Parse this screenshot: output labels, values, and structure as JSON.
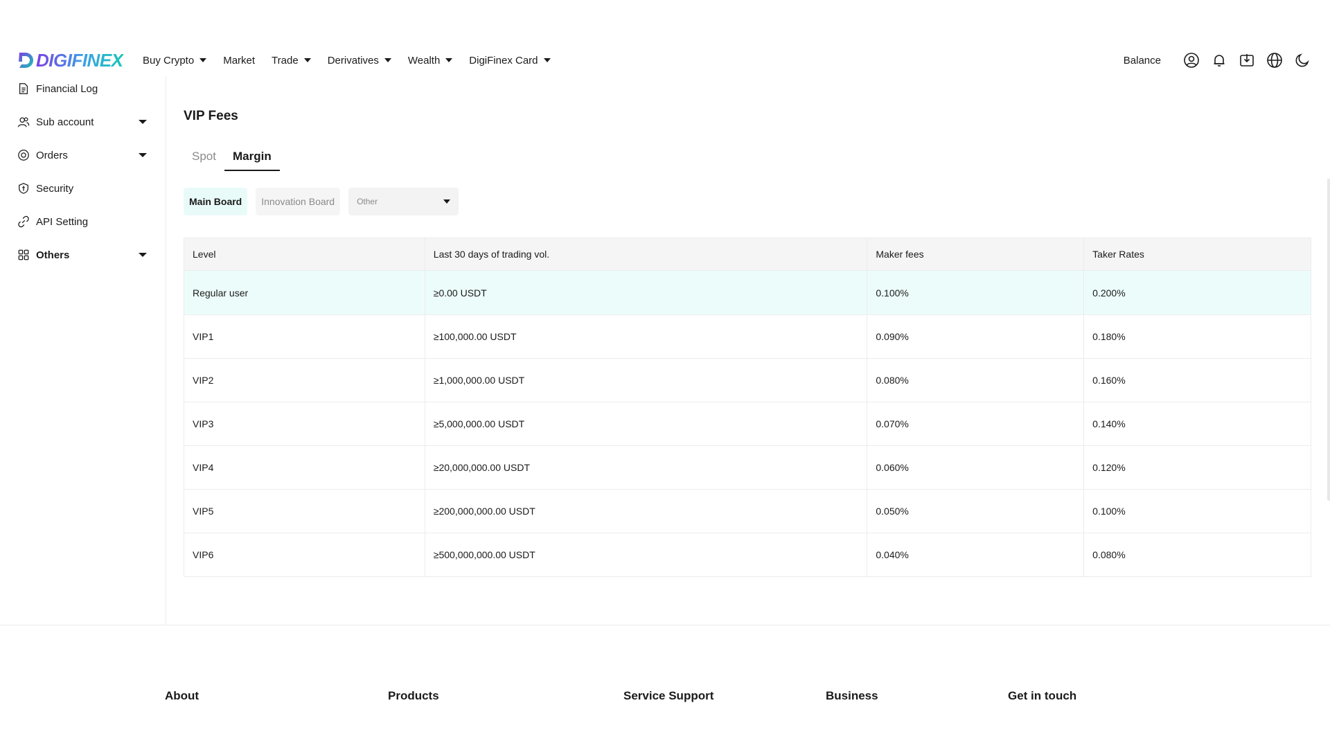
{
  "brand": {
    "name": "DIGIFINEX"
  },
  "nav": {
    "items": [
      {
        "label": "Buy Crypto",
        "dropdown": true
      },
      {
        "label": "Market",
        "dropdown": false
      },
      {
        "label": "Trade",
        "dropdown": true
      },
      {
        "label": "Derivatives",
        "dropdown": true
      },
      {
        "label": "Wealth",
        "dropdown": true
      },
      {
        "label": "DigiFinex Card",
        "dropdown": true
      }
    ],
    "balance_label": "Balance",
    "icons": [
      "user-icon",
      "bell-icon",
      "download-icon",
      "globe-icon",
      "moon-icon"
    ]
  },
  "sidebar": {
    "items": [
      {
        "label": "Financial Log",
        "icon": "file-icon",
        "dropdown": false
      },
      {
        "label": "Sub account",
        "icon": "users-icon",
        "dropdown": true
      },
      {
        "label": "Orders",
        "icon": "orders-icon",
        "dropdown": true
      },
      {
        "label": "Security",
        "icon": "shield-icon",
        "dropdown": false
      },
      {
        "label": "API Setting",
        "icon": "link-icon",
        "dropdown": false
      },
      {
        "label": "Others",
        "icon": "grid-icon",
        "dropdown": true
      }
    ]
  },
  "main": {
    "title": "VIP Fees",
    "tabs": [
      {
        "label": "Spot",
        "active": false
      },
      {
        "label": "Margin",
        "active": true
      }
    ],
    "boards": [
      {
        "label": "Main Board",
        "active": true
      },
      {
        "label": "Innovation Board",
        "active": false
      }
    ],
    "select": {
      "value": "Other"
    },
    "table": {
      "headers": [
        "Level",
        "Last 30 days of trading vol.",
        "Maker fees",
        "Taker Rates"
      ],
      "rows": [
        [
          "Regular user",
          "≥0.00 USDT",
          "0.100%",
          "0.200%"
        ],
        [
          "VIP1",
          "≥100,000.00 USDT",
          "0.090%",
          "0.180%"
        ],
        [
          "VIP2",
          "≥1,000,000.00 USDT",
          "0.080%",
          "0.160%"
        ],
        [
          "VIP3",
          "≥5,000,000.00 USDT",
          "0.070%",
          "0.140%"
        ],
        [
          "VIP4",
          "≥20,000,000.00 USDT",
          "0.060%",
          "0.120%"
        ],
        [
          "VIP5",
          "≥200,000,000.00 USDT",
          "0.050%",
          "0.100%"
        ],
        [
          "VIP6",
          "≥500,000,000.00 USDT",
          "0.040%",
          "0.080%"
        ]
      ]
    }
  },
  "footer": {
    "columns": [
      "About",
      "Products",
      "Service Support",
      "Business",
      "Get in touch"
    ]
  },
  "colors": {
    "highlight_row": "#ecfcfa",
    "active_board": "#e9fbf8",
    "brand_gradient_start": "#7b3fe4",
    "brand_gradient_end": "#18c6b4"
  }
}
